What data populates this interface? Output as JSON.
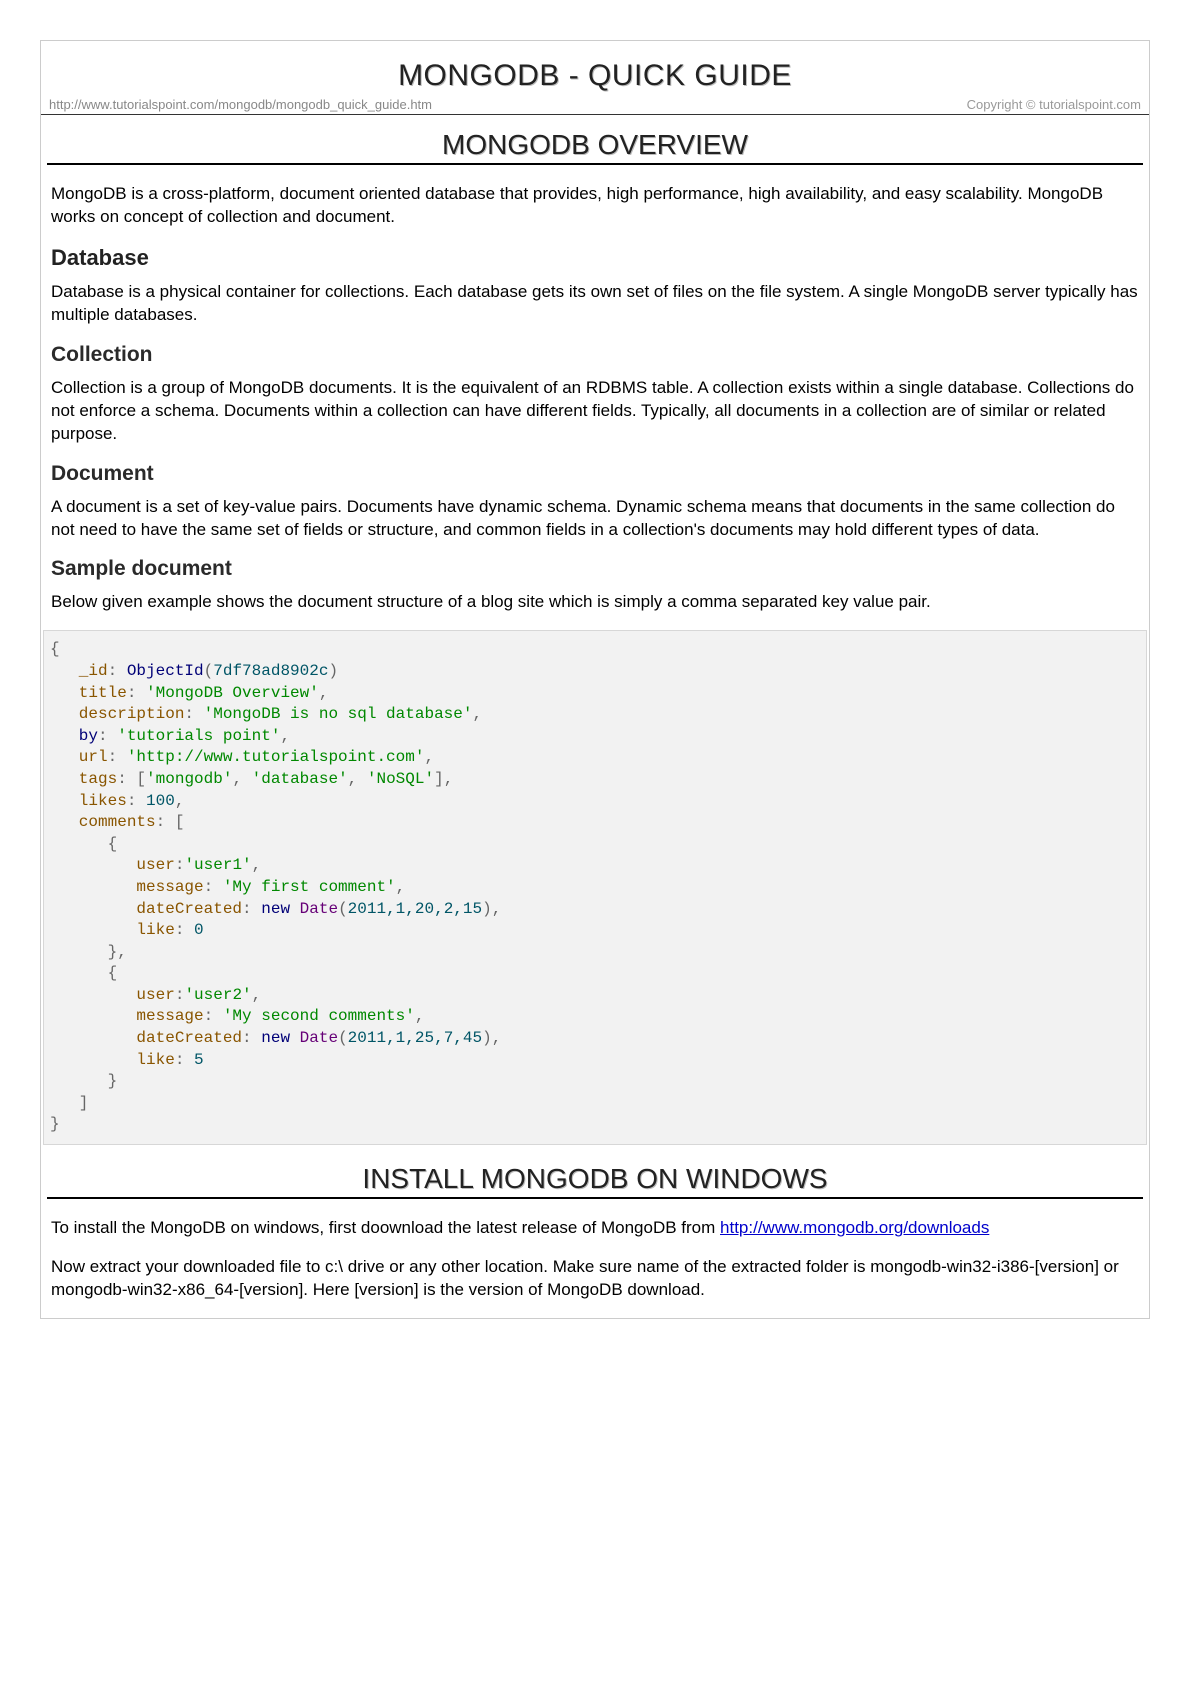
{
  "main_title": "MONGODB - QUICK GUIDE",
  "source_url": "http://www.tutorialspoint.com/mongodb/mongodb_quick_guide.htm",
  "copyright": "Copyright © tutorialspoint.com",
  "section1": {
    "title": "MONGODB OVERVIEW",
    "intro": "MongoDB is a cross-platform, document oriented database that provides, high performance, high availability, and easy scalability. MongoDB works on concept of collection and document.",
    "h_database": "Database",
    "p_database": "Database is a physical container for collections. Each database gets its own set of files on the file system. A single MongoDB server typically has multiple databases.",
    "h_collection": "Collection",
    "p_collection": "Collection is a group of MongoDB documents. It is the equivalent of an RDBMS table. A collection exists within a single database. Collections do not enforce a schema. Documents within a collection can have different fields. Typically, all documents in a collection are of similar or related purpose.",
    "h_document": "Document",
    "p_document": "A document is a set of key-value pairs. Documents have dynamic schema. Dynamic schema means that documents in the same collection do not need to have the same set of fields or structure, and common fields in a collection's documents may hold different types of data.",
    "h_sample": "Sample document",
    "p_sample": "Below given example shows the document structure of a blog site which is simply a comma separated key value pair."
  },
  "code": {
    "brace_open": "{",
    "l1_key": "   _id",
    "l1_colon": ": ",
    "l1_fn": "ObjectId",
    "l1_paren_o": "(",
    "l1_val": "7df78ad8902c",
    "l1_paren_c": ")",
    "l2": "   title",
    "l2_v": "'MongoDB Overview'",
    "l3": "   description",
    "l3_v": "'MongoDB is no sql database'",
    "l4": "   by",
    "l4_v": "'tutorials point'",
    "l5": "   url",
    "l5_v": "'http://www.tutorialspoint.com'",
    "l6": "   tags",
    "l6_bo": "[",
    "l6_a": "'mongodb'",
    "l6_b": "'database'",
    "l6_c": "'NoSQL'",
    "l6_bc": "],",
    "l7": "   likes",
    "l7_v": "100",
    "l8": "   comments",
    "l8_bo": "[",
    "c1_open": "      {",
    "c1_user_k": "         user",
    "c1_user_v": "'user1'",
    "c1_msg_k": "         message",
    "c1_msg_v": "'My first comment'",
    "c1_date_k": "         dateCreated",
    "c1_date_new": "new",
    "c1_date_fn": "Date",
    "c1_date_args": "2011,1,20,2,15",
    "c1_like_k": "         like",
    "c1_like_v": "0",
    "c1_close": "      },",
    "c2_open": "      {",
    "c2_user_k": "         user",
    "c2_user_v": "'user2'",
    "c2_msg_k": "         message",
    "c2_msg_v": "'My second comments'",
    "c2_date_k": "         dateCreated",
    "c2_date_new": "new",
    "c2_date_fn": "Date",
    "c2_date_args": "2011,1,25,7,45",
    "c2_like_k": "         like",
    "c2_like_v": "5",
    "c2_close": "      }",
    "arr_close": "   ]",
    "brace_close": "}"
  },
  "section2": {
    "title": "INSTALL MONGODB ON WINDOWS",
    "p1_a": "To install the MongoDB on windows, first doownload the latest release of MongoDB from ",
    "p1_link": "http://www.mongodb.org/downloads",
    "p2": "Now extract your downloaded file to c:\\ drive or any other location. Make sure name of the extracted folder is mongodb-win32-i386-[version] or mongodb-win32-x86_64-[version]. Here [version] is the version of MongoDB download."
  }
}
